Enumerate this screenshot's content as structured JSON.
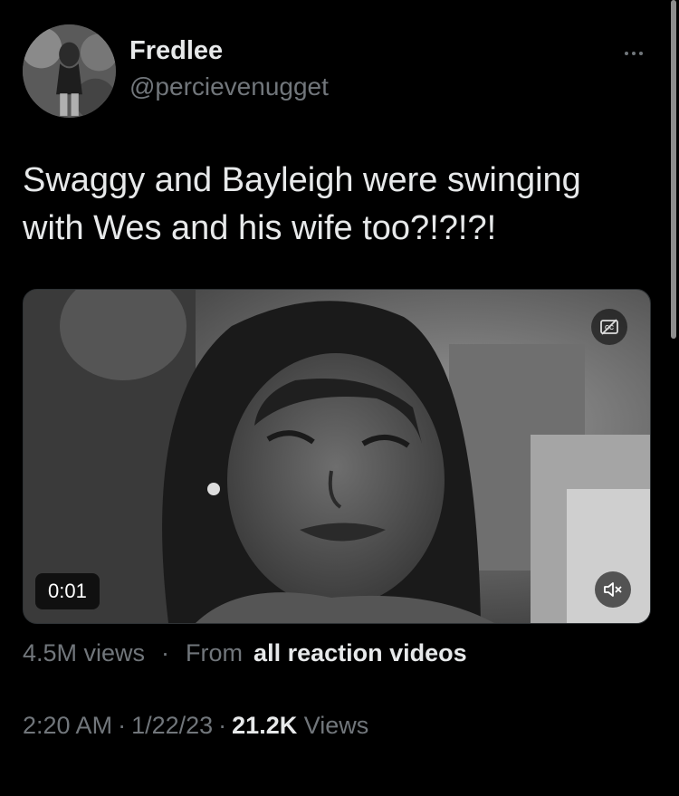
{
  "author": {
    "display_name": "Fredlee",
    "handle": "@percievenugget"
  },
  "tweet": {
    "text_line1": "Swaggy and Bayleigh were swinging",
    "text_line2": "with Wes and his wife too?!?!?!"
  },
  "video": {
    "time": "0:01",
    "cc_icon": "captions-off-icon",
    "mute_icon": "speaker-muted-icon"
  },
  "video_meta": {
    "views": "4.5M views",
    "separator": "·",
    "from_label": "From",
    "source": "all reaction videos"
  },
  "timestamp": {
    "time": "2:20 AM",
    "separator": "·",
    "date": "1/22/23",
    "views_count": "21.2K",
    "views_label": "Views"
  },
  "colors": {
    "background": "#000000",
    "primary_text": "#e7e9ea",
    "secondary_text": "#71767b"
  }
}
